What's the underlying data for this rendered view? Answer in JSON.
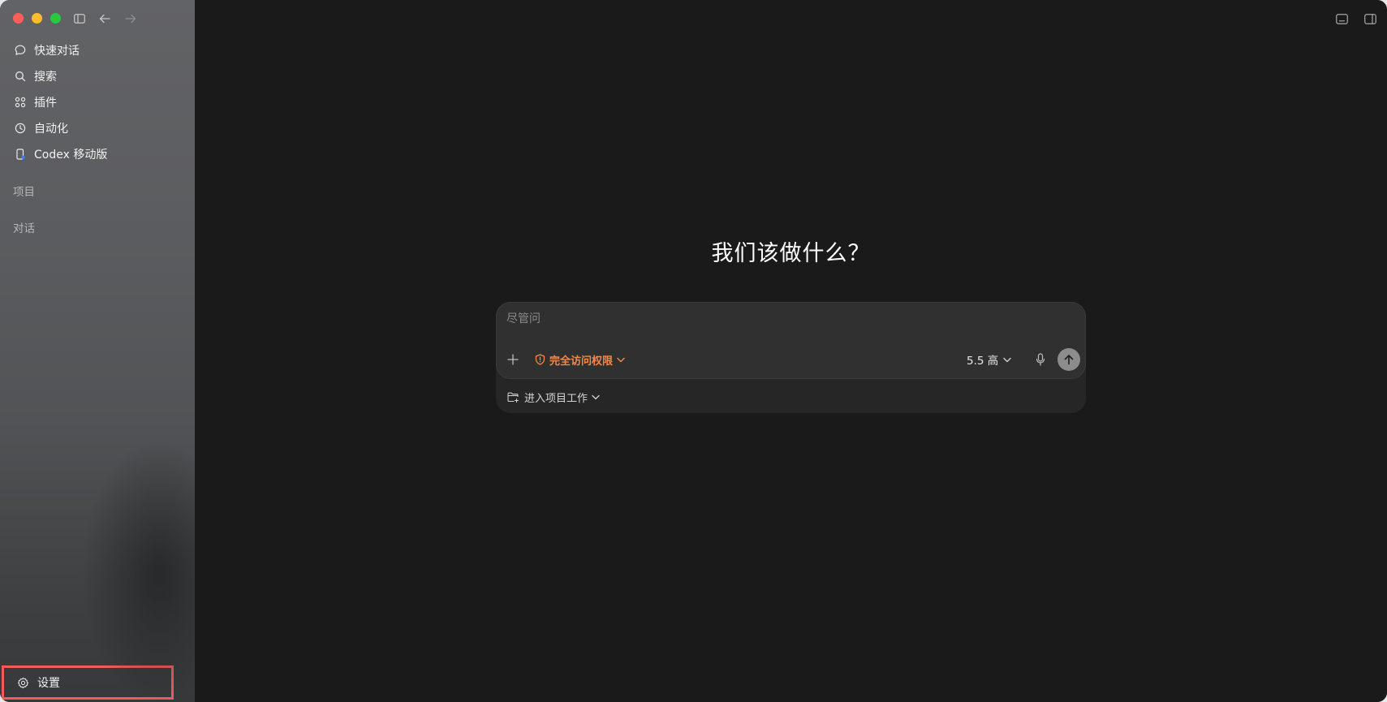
{
  "sidebar": {
    "items": [
      {
        "label": "快速对话",
        "icon": "chat-bubble-icon"
      },
      {
        "label": "搜索",
        "icon": "search-icon"
      },
      {
        "label": "插件",
        "icon": "plugins-grid-icon"
      },
      {
        "label": "自动化",
        "icon": "clock-icon"
      },
      {
        "label": "Codex 移动版",
        "icon": "mobile-icon"
      }
    ],
    "sections": {
      "projects": "项目",
      "conversations": "对话"
    },
    "settings_label": "设置"
  },
  "main": {
    "heading": "我们该做什么？",
    "composer": {
      "placeholder": "尽管问",
      "access_label": "完全访问权限",
      "model_label": "5.5 高",
      "project_label": "进入项目工作"
    }
  },
  "colors": {
    "accent_orange": "#f08a4b",
    "highlight_red": "#f45a5a",
    "send_button": "#8c8c8c"
  }
}
